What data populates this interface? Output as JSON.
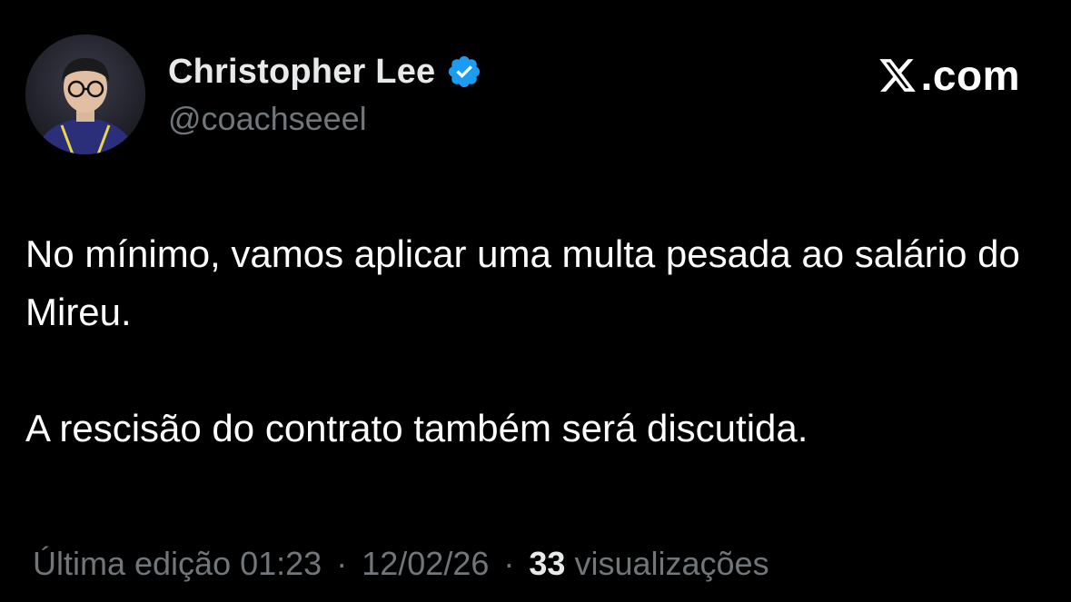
{
  "author": {
    "display_name": "Christopher Lee",
    "handle": "@coachseeel",
    "verified": true,
    "verified_color": "#1d9bf0"
  },
  "brand": {
    "label": ".com",
    "icon": "x-logo-icon"
  },
  "tweet": {
    "paragraphs": [
      "No mínimo, vamos aplicar uma multa pesada ao salário do Mireu.",
      "A rescisão do contrato também será discutida."
    ]
  },
  "meta": {
    "edited_label": "Última edição",
    "time": "01:23",
    "date": "12/02/26",
    "separator": "·",
    "views_count": "33",
    "views_label": "visualizações"
  },
  "colors": {
    "background": "#000000",
    "text_primary": "#ffffff",
    "text_secondary": "#71767b",
    "verified_badge": "#1d9bf0"
  }
}
